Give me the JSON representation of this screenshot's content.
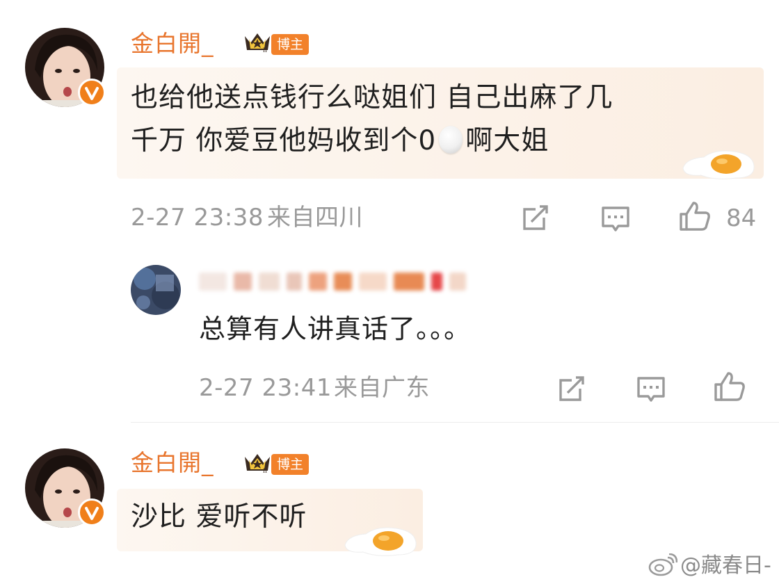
{
  "comments": [
    {
      "username": "金白開_",
      "badge": "博主",
      "text_line1": "也给他送点钱行么哒姐们 自己出麻了几",
      "text_line2_before_egg": "千万 你爱豆他妈收到个0",
      "text_line2_after_egg": "啊大姐",
      "time": "2-27 23:38",
      "location": "来自四川",
      "likes": "84"
    },
    {
      "username": "",
      "text": "总算有人讲真话了。。。",
      "time": "2-27 23:41",
      "location": "来自广东"
    },
    {
      "username": "金白開_",
      "badge": "博主",
      "text": "沙比 爱听不听"
    }
  ],
  "watermark": "@藏春日-",
  "colors": {
    "username": "#e8752d",
    "badge_bg": "#f2812a",
    "verified": "#f07f1a",
    "meta": "#999999"
  },
  "icons": [
    "repost-icon",
    "comment-icon",
    "like-icon",
    "verified-icon",
    "crown-icon",
    "fried-egg-icon",
    "weibo-logo-icon"
  ]
}
